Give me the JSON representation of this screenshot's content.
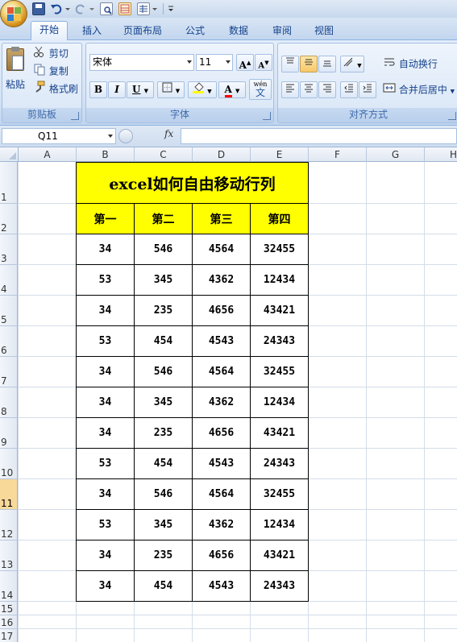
{
  "quick_access": {
    "icons": [
      "save-icon",
      "undo-icon",
      "redo-icon",
      "print-preview-icon",
      "insert-icon",
      "format-icon",
      "customize-qat-icon"
    ]
  },
  "tabs": [
    {
      "id": "home",
      "label": "开始",
      "active": true
    },
    {
      "id": "insert",
      "label": "插入",
      "active": false
    },
    {
      "id": "page-layout",
      "label": "页面布局",
      "active": false
    },
    {
      "id": "formulas",
      "label": "公式",
      "active": false
    },
    {
      "id": "data",
      "label": "数据",
      "active": false
    },
    {
      "id": "review",
      "label": "审阅",
      "active": false
    },
    {
      "id": "view",
      "label": "视图",
      "active": false
    }
  ],
  "ribbon": {
    "clipboard": {
      "label": "剪贴板",
      "paste": "粘贴",
      "cut": "剪切",
      "copy": "复制",
      "format_painter": "格式刷"
    },
    "font": {
      "label": "字体",
      "font_name": "宋体",
      "font_size": "11",
      "bold": "B",
      "italic": "I",
      "underline": "U",
      "grow": "A",
      "shrink": "A",
      "wen": "wén",
      "wen_char": "文",
      "font_color_letter": "A"
    },
    "alignment": {
      "label": "对齐方式",
      "wrap_text": "自动换行",
      "merge_center": "合并后居中"
    },
    "colors": {
      "highlight": "#ffff00",
      "font_color": "#ff0000",
      "accent": "#15428b"
    }
  },
  "formula_bar": {
    "name_box": "Q11",
    "fx_label": "fx",
    "formula": ""
  },
  "sheet": {
    "columns": [
      "A",
      "B",
      "C",
      "D",
      "E",
      "F",
      "G",
      "H"
    ],
    "rows": [
      "1",
      "2",
      "3",
      "4",
      "5",
      "6",
      "7",
      "8",
      "9",
      "10",
      "11",
      "12",
      "13",
      "14",
      "15",
      "16",
      "17"
    ],
    "selected_row": "11",
    "title": "excel如何自由移动行列",
    "headers": [
      "第一",
      "第二",
      "第三",
      "第四"
    ],
    "data": [
      [
        "34",
        "546",
        "4564",
        "32455"
      ],
      [
        "53",
        "345",
        "4362",
        "12434"
      ],
      [
        "34",
        "235",
        "4656",
        "43421"
      ],
      [
        "53",
        "454",
        "4543",
        "24343"
      ],
      [
        "34",
        "546",
        "4564",
        "32455"
      ],
      [
        "34",
        "345",
        "4362",
        "12434"
      ],
      [
        "34",
        "235",
        "4656",
        "43421"
      ],
      [
        "53",
        "454",
        "4543",
        "24343"
      ],
      [
        "34",
        "546",
        "4564",
        "32455"
      ],
      [
        "53",
        "345",
        "4362",
        "12434"
      ],
      [
        "34",
        "235",
        "4656",
        "43421"
      ],
      [
        "34",
        "454",
        "4543",
        "24343"
      ]
    ]
  }
}
